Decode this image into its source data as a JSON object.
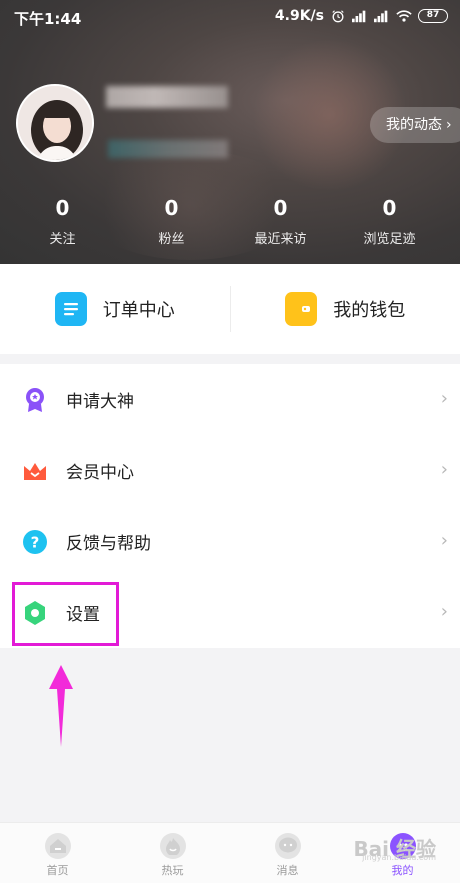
{
  "status_bar": {
    "time": "下午1:44",
    "speed": "4.9K/s",
    "battery": "87"
  },
  "profile": {
    "dynamic_button": "我的动态",
    "stats": [
      {
        "value": "0",
        "label": "关注"
      },
      {
        "value": "0",
        "label": "粉丝"
      },
      {
        "value": "0",
        "label": "最近来访"
      },
      {
        "value": "0",
        "label": "浏览足迹"
      }
    ]
  },
  "quick_actions": [
    {
      "label": "订单中心",
      "icon": "order-icon",
      "color": "#1fb6f4"
    },
    {
      "label": "我的钱包",
      "icon": "wallet-icon",
      "color": "#ffc21a"
    }
  ],
  "menu": [
    {
      "label": "申请大神",
      "icon": "medal-icon",
      "color": "#8a52f8"
    },
    {
      "label": "会员中心",
      "icon": "crown-icon",
      "color": "#ff5a3c"
    },
    {
      "label": "反馈与帮助",
      "icon": "help-icon",
      "color": "#1ec2f0"
    },
    {
      "label": "设置",
      "icon": "settings-icon",
      "color": "#37d47c"
    }
  ],
  "nav": [
    {
      "label": "首页",
      "icon": "home-icon"
    },
    {
      "label": "热玩",
      "icon": "flame-icon"
    },
    {
      "label": "消息",
      "icon": "message-icon"
    },
    {
      "label": "我的",
      "icon": "profile-icon"
    }
  ],
  "watermark": {
    "text": "Bai 经验",
    "sub": "jingyan.baidu.com"
  },
  "accent": "#e21ad6"
}
